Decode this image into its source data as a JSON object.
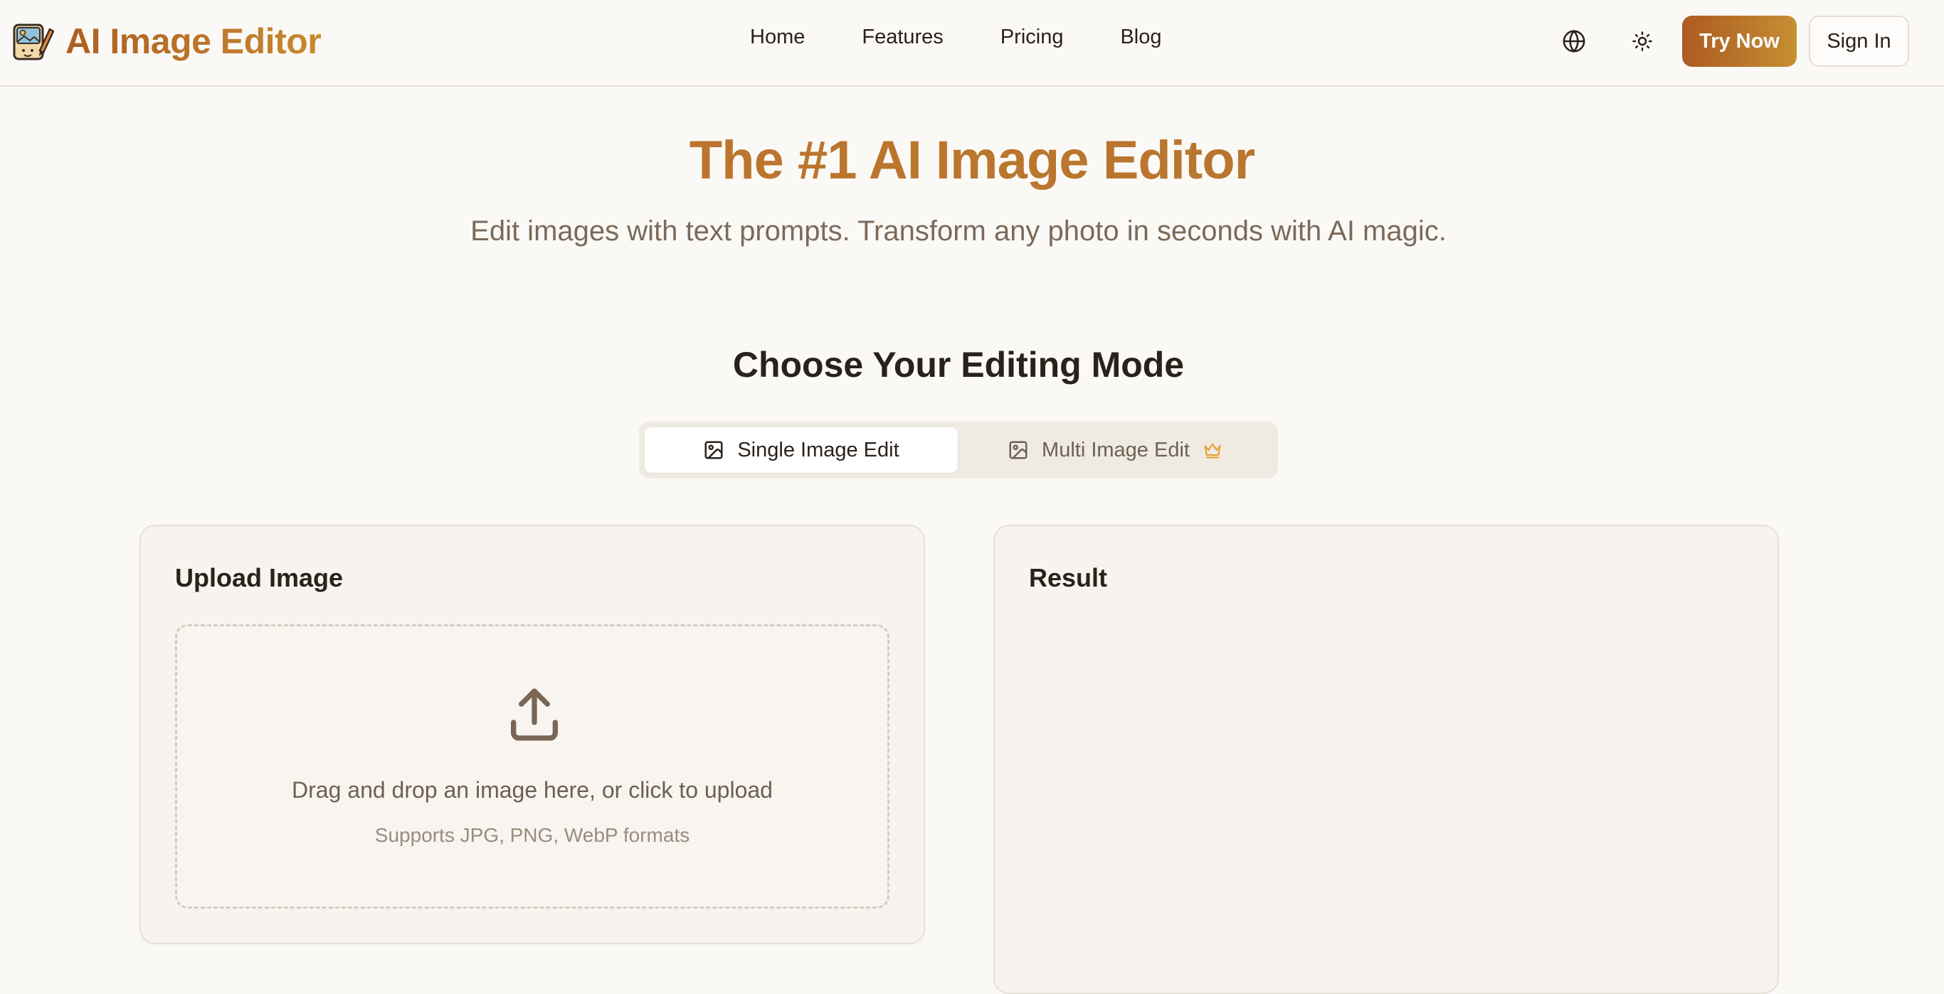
{
  "brand": {
    "name": "AI Image Editor",
    "logo_icon": "image-pencil-logo-icon"
  },
  "nav": {
    "items": [
      {
        "label": "Home"
      },
      {
        "label": "Features"
      },
      {
        "label": "Pricing"
      },
      {
        "label": "Blog"
      }
    ]
  },
  "header_actions": {
    "language_icon": "globe-icon",
    "theme_icon": "sun-icon",
    "try_label": "Try Now",
    "signin_label": "Sign In"
  },
  "hero": {
    "title": "The #1 AI Image Editor",
    "subtitle": "Edit images with text prompts. Transform any photo in seconds with AI magic."
  },
  "modes": {
    "title": "Choose Your Editing Mode",
    "tabs": [
      {
        "label": "Single Image Edit",
        "icon": "image-icon",
        "active": true
      },
      {
        "label": "Multi Image Edit",
        "icon": "image-icon",
        "badge_icon": "crown-icon",
        "active": false
      }
    ]
  },
  "upload": {
    "title": "Upload Image",
    "drop_text": "Drag and drop an image here, or click to upload",
    "formats_text": "Supports JPG, PNG, WebP formats",
    "icon": "upload-icon"
  },
  "result": {
    "title": "Result"
  },
  "colors": {
    "accent_start": "#ad5a22",
    "accent_end": "#c58f32",
    "background": "#fbf9f6",
    "crown": "#e6a43a"
  }
}
